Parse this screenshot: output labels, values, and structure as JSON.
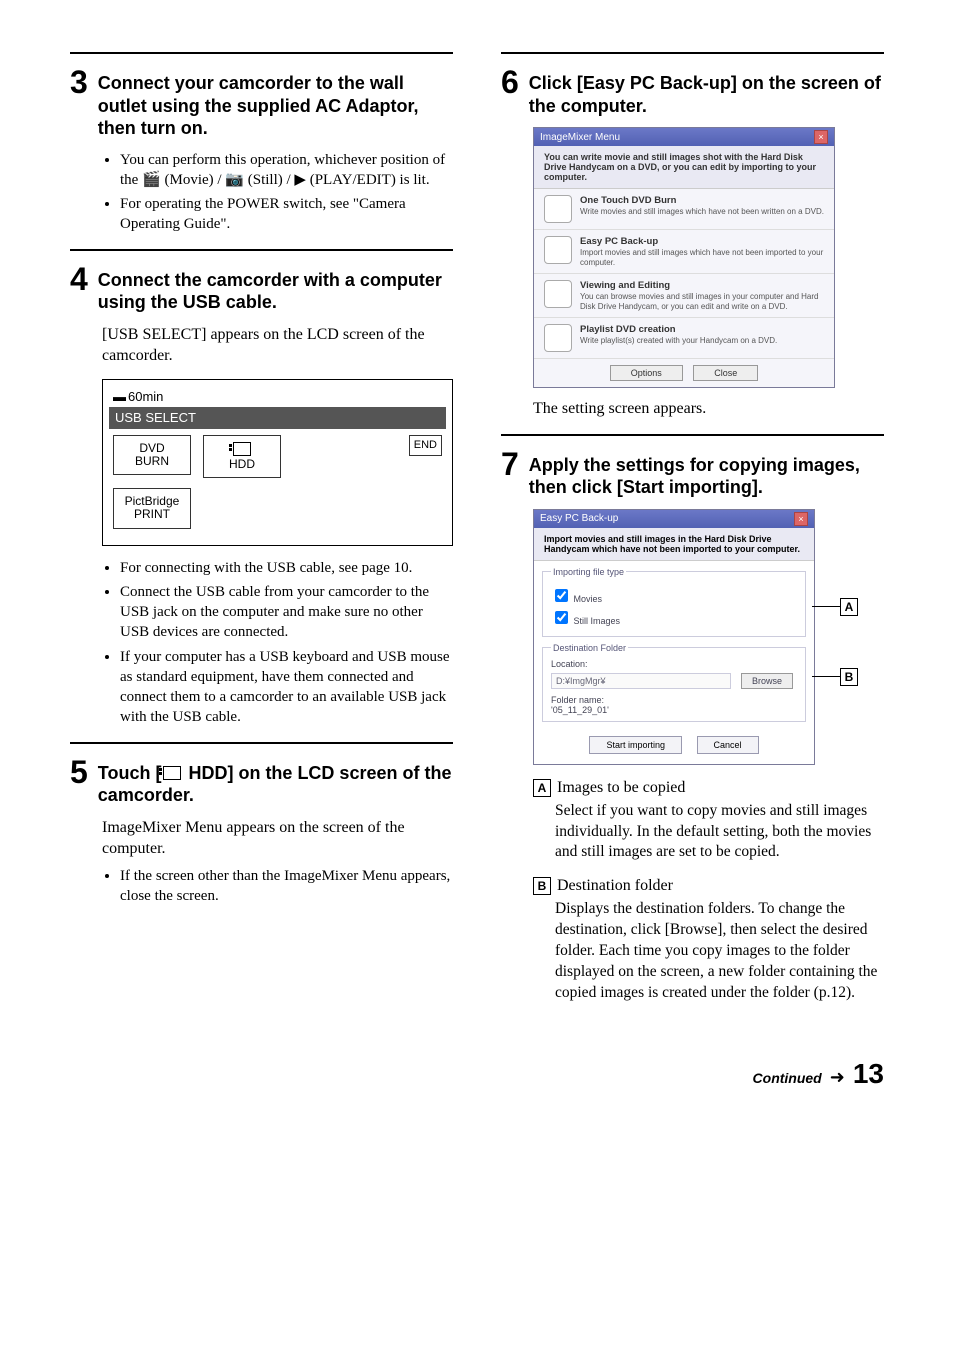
{
  "left": {
    "step3": {
      "num": "3",
      "title": "Connect your camcorder to the wall outlet using the supplied AC Adaptor, then turn on.",
      "bullets": [
        "You can perform this operation, whichever position of the 🎬 (Movie) / 📷 (Still) / ▶ (PLAY/EDIT) is lit.",
        "For operating the POWER switch, see \"Camera Operating Guide\"."
      ]
    },
    "step4": {
      "num": "4",
      "title": "Connect the camcorder with a computer using the USB cable.",
      "intro": "[USB SELECT] appears on the LCD screen of the camcorder.",
      "lcd": {
        "battery": "60min",
        "title": "USB SELECT",
        "btn_dvd": "DVD\nBURN",
        "btn_hdd": "HDD",
        "end": "END",
        "btn_pict": "PictBridge\nPRINT"
      },
      "bullets": [
        "For connecting with the USB cable, see page 10.",
        "Connect the USB cable from your camcorder to the USB jack on the computer and make sure no other USB devices are connected.",
        "If your computer has a USB keyboard and USB mouse as standard equipment, have them connected and connect them to a camcorder to an available USB jack with the USB cable."
      ]
    },
    "step5": {
      "num": "5",
      "title_pre": "Touch [",
      "title_post": " HDD] on the LCD screen of the camcorder.",
      "intro": "ImageMixer Menu appears on the screen of the computer.",
      "bullets": [
        "If the screen other than the ImageMixer Menu appears, close the screen."
      ]
    }
  },
  "right": {
    "step6": {
      "num": "6",
      "title": "Click [Easy PC Back-up] on the screen of the computer.",
      "window": {
        "title": "ImageMixer Menu",
        "sub": "You can write movie and still images shot with the Hard Disk Drive Handycam on a DVD, or you can edit by importing to your computer.",
        "rows": [
          {
            "h": "One Touch DVD Burn",
            "d": "Write movies and still images which have not been written on a DVD."
          },
          {
            "h": "Easy PC Back-up",
            "d": "Import movies and still images which have not been imported to your computer."
          },
          {
            "h": "Viewing and Editing",
            "d": "You can browse movies and still images in your computer and Hard Disk Drive Handycam, or you can edit and write on a DVD."
          },
          {
            "h": "Playlist DVD creation",
            "d": "Write playlist(s) created with your Handycam on a DVD."
          }
        ],
        "btn_options": "Options",
        "btn_close": "Close"
      },
      "after": "The setting screen appears."
    },
    "step7": {
      "num": "7",
      "title": "Apply the settings for copying images, then click [Start importing].",
      "dialog": {
        "title": "Easy PC Back-up",
        "sub": "Import movies and still images in the Hard Disk Drive Handycam which have not been imported to your computer.",
        "fs1_legend": "Importing file type",
        "chk_movies": "Movies",
        "chk_still": "Still Images",
        "fs2_legend": "Destination Folder",
        "loc_label": "Location:",
        "loc_value": "D:¥ImgMgr¥",
        "browse": "Browse",
        "folder_label": "Folder name:",
        "folder_value": "'05_11_29_01'",
        "btn_start": "Start importing",
        "btn_cancel": "Cancel"
      },
      "labels": {
        "A": "A",
        "B": "B",
        "A_title": "Images to be copied",
        "A_desc": "Select if you want to copy movies and still images individually. In the default setting, both the movies and still images are set to be copied.",
        "B_title": "Destination folder",
        "B_desc": "Displays the destination folders. To change the destination, click [Browse], then select the desired folder. Each time you copy images to the folder displayed on the screen, a new folder containing the copied images is created under the folder (p.12)."
      }
    }
  },
  "footer": {
    "continued": "Continued",
    "arrow": "➜",
    "page": "13"
  }
}
